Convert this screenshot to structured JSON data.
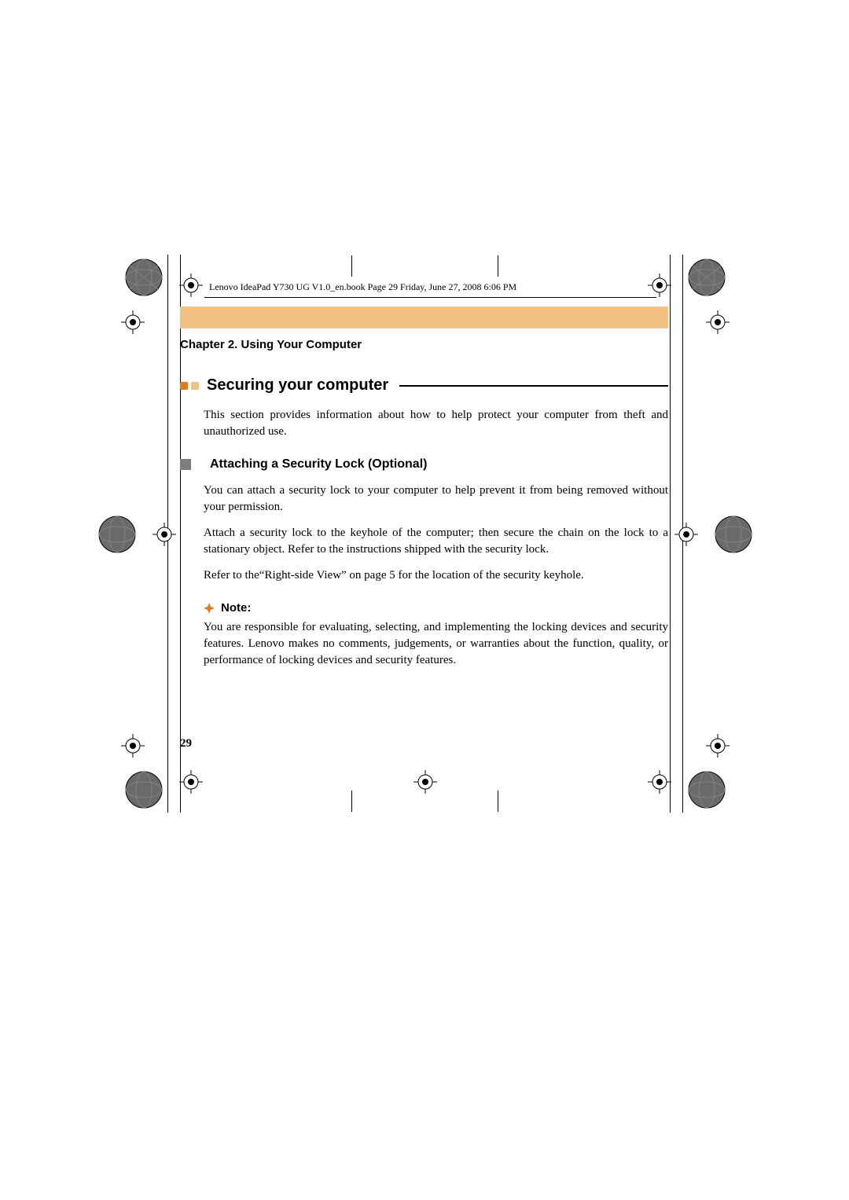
{
  "header": {
    "book_line": "Lenovo IdeaPad Y730 UG V1.0_en.book  Page 29  Friday, June 27, 2008  6:06 PM"
  },
  "chapter": "Chapter 2. Using Your Computer",
  "section": {
    "title": "Securing your computer",
    "intro": "This section provides information about how to help protect your computer from theft and unauthorized use."
  },
  "subsection": {
    "title": "Attaching a Security Lock (Optional)",
    "para1": "You can attach a security lock to your computer to help prevent it from being removed without your permission.",
    "para2": "Attach a security lock to the keyhole of the computer; then secure the chain on the lock to a stationary object. Refer to the instructions shipped with the security lock.",
    "para3": "Refer to the“Right-side View” on page 5 for the location of the security keyhole."
  },
  "note": {
    "label": "Note:",
    "text": "You are responsible for evaluating, selecting, and implementing the locking devices and security features. Lenovo makes no comments, judgements, or warranties about the function, quality, or performance of locking devices and security features."
  },
  "page_number": "29"
}
